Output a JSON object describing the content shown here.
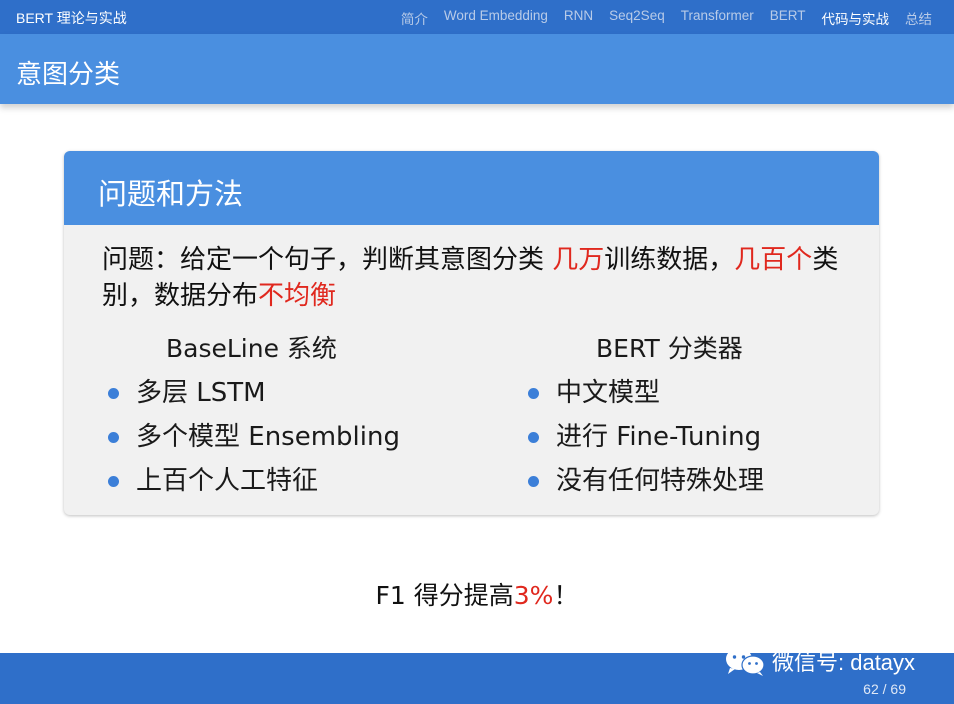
{
  "header": {
    "deck_title": "BERT 理论与实战",
    "nav": [
      {
        "label": "简介",
        "active": false
      },
      {
        "label": "Word Embedding",
        "active": false
      },
      {
        "label": "RNN",
        "active": false
      },
      {
        "label": "Seq2Seq",
        "active": false
      },
      {
        "label": "Transformer",
        "active": false
      },
      {
        "label": "BERT",
        "active": false
      },
      {
        "label": "代码与实战",
        "active": true
      },
      {
        "label": "总结",
        "active": false
      }
    ]
  },
  "frame": {
    "title": "意图分类"
  },
  "block": {
    "title": "问题和方法",
    "problem": {
      "part1": "问题：给定一个句子，判断其意图分类 ",
      "highlight1": "几万",
      "part2": "训练数据，",
      "highlight2": "几百个",
      "part3": "类别，数据分布",
      "highlight3": "不均衡"
    },
    "left": {
      "heading": "BaseLine 系统",
      "items": [
        "多层 LSTM",
        "多个模型 Ensembling",
        "上百个人工特征"
      ]
    },
    "right": {
      "heading": "BERT 分类器",
      "items": [
        "中文模型",
        "进行 Fine-Tuning",
        "没有任何特殊处理"
      ]
    }
  },
  "conclusion": {
    "prefix": "F1 得分提高",
    "highlight": "3%",
    "suffix": "！"
  },
  "footer": {
    "watermark": "微信号: datayx",
    "watermark_icon": "wechat-icon",
    "page": "62 / 69"
  },
  "colors": {
    "nav_bar": "#2f6fc9",
    "title_bar": "#4a8fe0",
    "highlight": "#e0281e",
    "bullet": "#3c7fd8"
  }
}
